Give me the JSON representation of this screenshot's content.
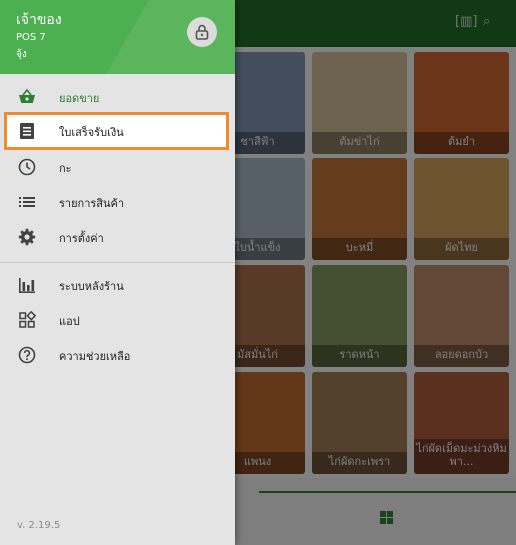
{
  "drawer": {
    "shop_name": "เจ้าของ",
    "pos_name": "POS 7",
    "user_name": "จุ้ง",
    "menu_items": [
      {
        "label": "ยอดขาย",
        "icon": "basket-icon"
      },
      {
        "label": "ใบเสร็จรับเงิน",
        "icon": "receipt-icon"
      },
      {
        "label": "กะ",
        "icon": "clock-icon"
      },
      {
        "label": "รายการสินค้า",
        "icon": "list-icon"
      },
      {
        "label": "การตั้งค่า",
        "icon": "gear-icon"
      },
      {
        "label": "ระบบหลังร้าน",
        "icon": "bar-chart-icon"
      },
      {
        "label": "แอป",
        "icon": "apps-icon"
      },
      {
        "label": "ความช่วยเหลือ",
        "icon": "help-icon"
      }
    ],
    "version": "v. 2.19.5"
  },
  "background": {
    "tiles": [
      {
        "label": "ชาสีฟ้า",
        "color": "#7b8fa8"
      },
      {
        "label": "ต้มข่าไก่",
        "color": "#c9b48e"
      },
      {
        "label": "ต้มยำ",
        "color": "#c4622e"
      },
      {
        "label": "ใบน้ำแข็ง",
        "color": "#9fb0bb"
      },
      {
        "label": "บะหมี่",
        "color": "#b86d33"
      },
      {
        "label": "ผัดไทย",
        "color": "#c99a55"
      },
      {
        "label": "มัสมั่นไก่",
        "color": "#a06a45"
      },
      {
        "label": "ราดหน้า",
        "color": "#7c8f5a"
      },
      {
        "label": "ลอยดอกบัว",
        "color": "#b48465"
      },
      {
        "label": "แพนง",
        "color": "#b5652e"
      },
      {
        "label": "ไก่ผัดกะเพรา",
        "color": "#9a7550"
      },
      {
        "label": "ไก่ผัดเม็ดมะม่วงหิมพา...",
        "color": "#a8583a"
      }
    ]
  },
  "colors": {
    "header_green": "#4caf50",
    "accent_green": "#2e7d32",
    "highlight_orange": "#f08a2a"
  }
}
